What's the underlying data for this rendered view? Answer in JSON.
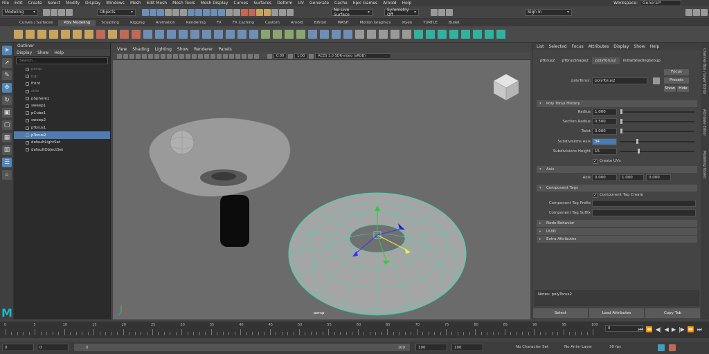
{
  "menubar": {
    "items": [
      "File",
      "Edit",
      "Create",
      "Select",
      "Modify",
      "Display",
      "Windows",
      "Mesh",
      "Edit Mesh",
      "Mesh Tools",
      "Mesh Display",
      "Curves",
      "Surfaces",
      "Deform",
      "UV",
      "Generate",
      "Cache",
      "Epic Games",
      "Arnold",
      "Help"
    ],
    "workspace_label": "Workspace:",
    "workspace_value": "General*"
  },
  "statusline": {
    "mode": "Modeling",
    "selection_mode": "Objects",
    "live_surface": "No Live Surface",
    "symmetry": "Symmetry: Off",
    "sign_in": "Sign In"
  },
  "shelf": {
    "tabs": [
      "Curves / Surfaces",
      "Poly Modeling",
      "Sculpting",
      "Rigging",
      "Animation",
      "Rendering",
      "FX",
      "FX Caching",
      "Custom",
      "Arnold",
      "Bifrost",
      "MASH",
      "Motion Graphics",
      "XGen",
      "TURTLE",
      "Bullet"
    ],
    "active_tab": "Poly Modeling"
  },
  "outliner": {
    "title": "Outliner",
    "menu": [
      "Display",
      "Show",
      "Help"
    ],
    "search_placeholder": "Search...",
    "items": [
      {
        "label": "persp",
        "dim": true
      },
      {
        "label": "top",
        "dim": true
      },
      {
        "label": "front",
        "dim": false
      },
      {
        "label": "side",
        "dim": true
      },
      {
        "label": "pSphere1",
        "dim": false
      },
      {
        "label": "sweep1",
        "dim": false
      },
      {
        "label": "pCube1",
        "dim": false
      },
      {
        "label": "sweep2",
        "dim": false
      },
      {
        "label": "pTorus1",
        "dim": false
      },
      {
        "label": "pTorus2",
        "dim": false,
        "selected": true
      },
      {
        "label": "defaultLightSet",
        "dim": false
      },
      {
        "label": "defaultObjectSet",
        "dim": false
      }
    ]
  },
  "viewport": {
    "menu": [
      "View",
      "Shading",
      "Lighting",
      "Show",
      "Renderer",
      "Panels"
    ],
    "value_a": "0.00",
    "value_b": "1.00",
    "colorspace": "ACES 1.0 SDR-video (sRGB)",
    "camera_label": "persp"
  },
  "attribute_editor": {
    "menu": [
      "List",
      "Selected",
      "Focus",
      "Attributes",
      "Display",
      "Show",
      "Help"
    ],
    "tabs": [
      "pTorus2",
      "pTorusShape2",
      "polyTorus2",
      "initialShadingGroup"
    ],
    "active_tab": "polyTorus2",
    "node_label": "polyTorus:",
    "node_name": "polyTorus2",
    "focus_btn": "Focus",
    "presets_btn": "Presets",
    "show_btn": "Show",
    "hide_btn": "Hide",
    "history_section": "Poly Torus History",
    "radius_label": "Radius",
    "radius_value": "1.000",
    "section_radius_label": "Section Radius",
    "section_radius_value": "0.500",
    "twist_label": "Twist",
    "twist_value": "0.000",
    "subdiv_axis_label": "Subdivisions Axis",
    "subdiv_axis_value": "34",
    "subdiv_height_label": "Subdivisions Height",
    "subdiv_height_value": "15",
    "create_uvs_label": "Create UVs",
    "axis_section": "Axis",
    "axis_label": "Axis",
    "axis_x": "0.000",
    "axis_y": "1.000",
    "axis_z": "0.000",
    "tags_section": "Component Tags",
    "tag_create_label": "Component Tag Create",
    "tag_prefix_label": "Component Tag Prefix",
    "tag_suffix_label": "Component Tag Suffix",
    "node_behavior_section": "Node Behavior",
    "uuid_section": "UUID",
    "extra_section": "Extra Attributes",
    "notes": "Notes: polyTorus2",
    "select_btn": "Select",
    "load_btn": "Load Attributes",
    "copy_btn": "Copy Tab"
  },
  "side_tabs": [
    "Channel Box / Layer Editor",
    "Attribute Editor",
    "Modeling Toolkit"
  ],
  "timeline": {
    "labels": [
      "0",
      "5",
      "10",
      "15",
      "20",
      "25",
      "30",
      "35",
      "40",
      "45",
      "50",
      "55",
      "60",
      "65",
      "70",
      "75",
      "80",
      "85",
      "90",
      "95",
      "100"
    ],
    "current_frame": "0"
  },
  "range": {
    "start": "0",
    "start_inner": "0",
    "slider_start": "0",
    "slider_end": "100",
    "end_inner": "100",
    "end": "100",
    "character_set": "No Character Set",
    "anim_layer": "No Anim Layer",
    "fps": "30 fps"
  }
}
